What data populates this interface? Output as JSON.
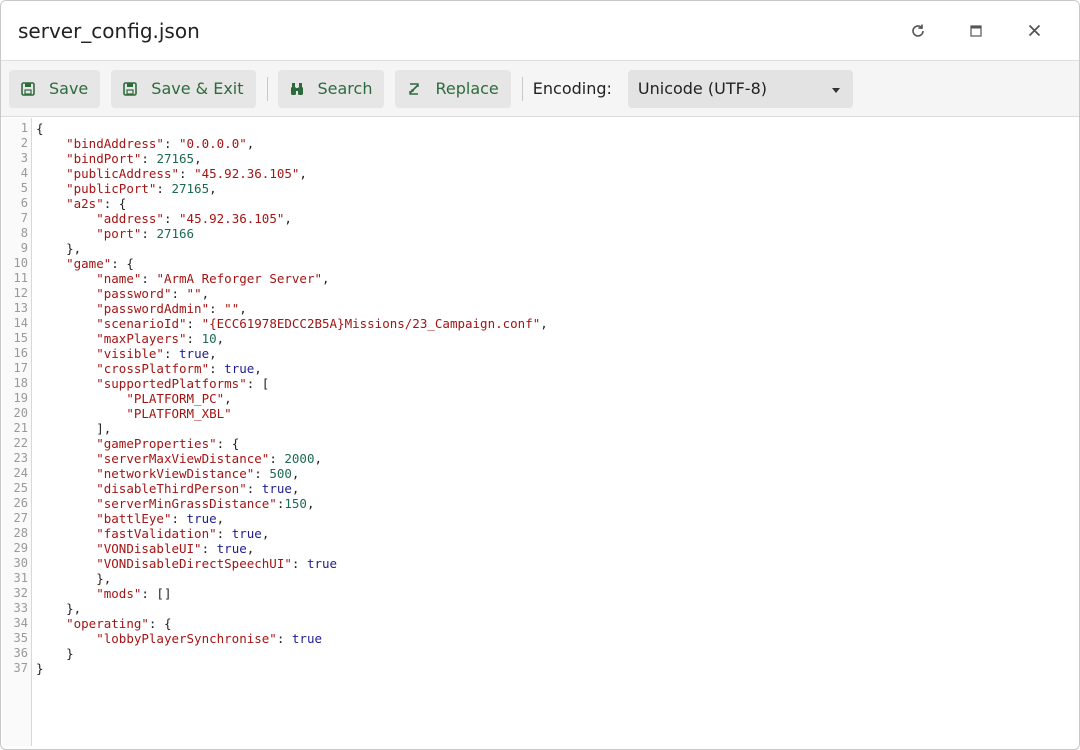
{
  "window": {
    "title": "server_config.json"
  },
  "toolbar": {
    "save_label": "Save",
    "save_exit_label": "Save & Exit",
    "search_label": "Search",
    "replace_label": "Replace",
    "encoding_label": "Encoding:",
    "encoding_value": "Unicode (UTF-8)"
  },
  "editor": {
    "lines": [
      "{",
      "    \"bindAddress\": \"0.0.0.0\",",
      "    \"bindPort\": 27165,",
      "    \"publicAddress\": \"45.92.36.105\",",
      "    \"publicPort\": 27165,",
      "    \"a2s\": {",
      "        \"address\": \"45.92.36.105\",",
      "        \"port\": 27166",
      "    },",
      "    \"game\": {",
      "        \"name\": \"ArmA Reforger Server\",",
      "        \"password\": \"\",",
      "        \"passwordAdmin\": \"\",",
      "        \"scenarioId\": \"{ECC61978EDCC2B5A}Missions/23_Campaign.conf\",",
      "        \"maxPlayers\": 10,",
      "        \"visible\": true,",
      "        \"crossPlatform\": true,",
      "        \"supportedPlatforms\": [",
      "            \"PLATFORM_PC\",",
      "            \"PLATFORM_XBL\"",
      "        ],",
      "        \"gameProperties\": {",
      "        \"serverMaxViewDistance\": 2000,",
      "        \"networkViewDistance\": 500,",
      "        \"disableThirdPerson\": true,",
      "        \"serverMinGrassDistance\":150,",
      "        \"battlEye\": true,",
      "        \"fastValidation\": true,",
      "        \"VONDisableUI\": true,",
      "        \"VONDisableDirectSpeechUI\": true",
      "        },",
      "        \"mods\": []",
      "    },",
      "    \"operating\": {",
      "        \"lobbyPlayerSynchronise\": true",
      "    }",
      "}"
    ]
  }
}
